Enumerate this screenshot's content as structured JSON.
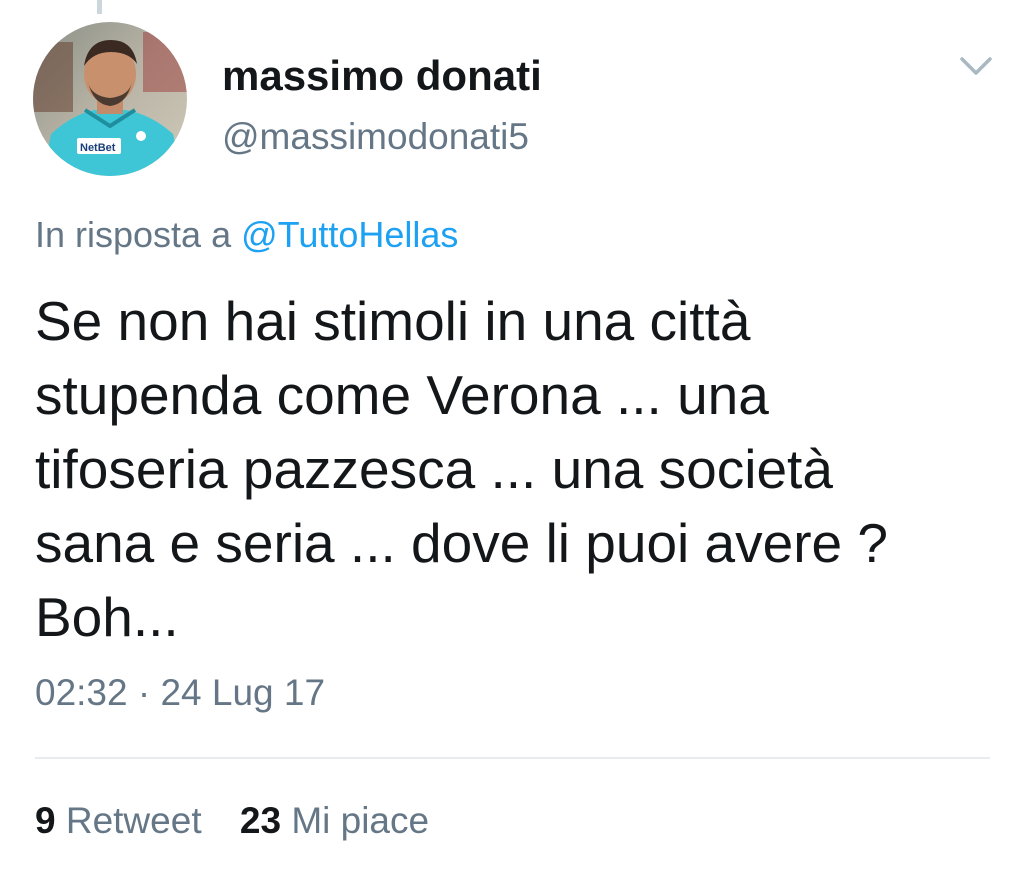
{
  "tweet": {
    "author": {
      "display_name": "massimo donati",
      "handle": "@massimodonati5",
      "avatar_icon": "profile-photo"
    },
    "reply_context": {
      "prefix": "In risposta a",
      "mention": "@TuttoHellas"
    },
    "text": "Se non hai stimoli in una città\nstupenda come Verona ... una\ntifoseria pazzesca ... una società\nsana e seria ... dove li puoi avere ?\nBoh...",
    "timestamp": "02:32 · 24 Lug 17",
    "stats": {
      "retweets_count": "9",
      "retweets_label": "Retweet",
      "likes_count": "23",
      "likes_label": "Mi piace"
    },
    "menu_icon": "chevron-down-icon"
  },
  "colors": {
    "link": "#1da1f2",
    "secondary_text": "#657786",
    "primary_text": "#14171a",
    "divider": "#e6ecf0"
  }
}
